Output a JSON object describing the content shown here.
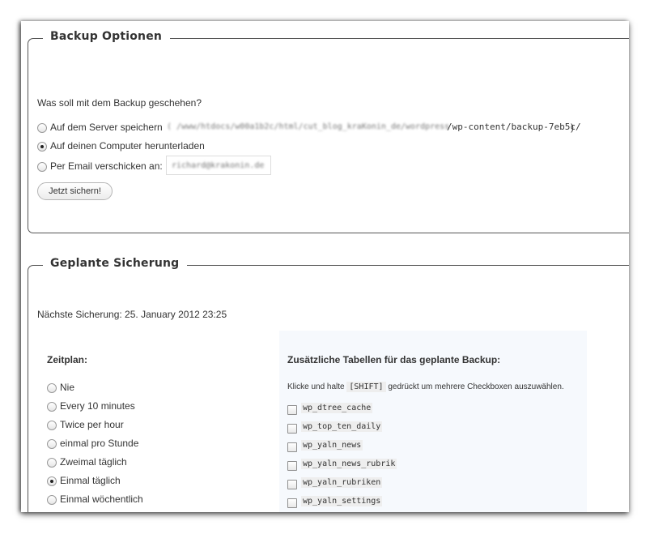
{
  "backup_options": {
    "legend": "Backup Optionen",
    "question": "Was soll mit dem Backup geschehen?",
    "options": [
      {
        "label": "Auf dem Server speichern",
        "checked": false
      },
      {
        "label": "Auf deinen Computer herunterladen",
        "checked": true
      },
      {
        "label": "Per Email verschicken an:",
        "checked": false
      }
    ],
    "server_path_visible": "/wp-content/backup-7eb5c/",
    "server_path_close": ")",
    "submit_label": "Jetzt sichern!"
  },
  "scheduled": {
    "legend": "Geplante Sicherung",
    "next_backup": "Nächste Sicherung: 25. January 2012 23:25",
    "schedule_title": "Zeitplan:",
    "schedule_options": [
      {
        "label": "Nie",
        "checked": false
      },
      {
        "label": "Every 10 minutes",
        "checked": false
      },
      {
        "label": "Twice per hour",
        "checked": false
      },
      {
        "label": "einmal pro Stunde",
        "checked": false
      },
      {
        "label": "Zweimal täglich",
        "checked": false
      },
      {
        "label": "Einmal täglich",
        "checked": true
      },
      {
        "label": "Einmal wöchentlich",
        "checked": false
      }
    ],
    "tables_title": "Zusätzliche Tabellen für das geplante Backup:",
    "hint_prefix": "Klicke und halte",
    "hint_key": "[SHIFT]",
    "hint_suffix": "gedrückt um mehrere Checkboxen auszuwählen.",
    "tables": [
      "wp_dtree_cache",
      "wp_top_ten_daily",
      "wp_yaln_news",
      "wp_yaln_news_rubrik",
      "wp_yaln_rubriken",
      "wp_yaln_settings"
    ]
  }
}
